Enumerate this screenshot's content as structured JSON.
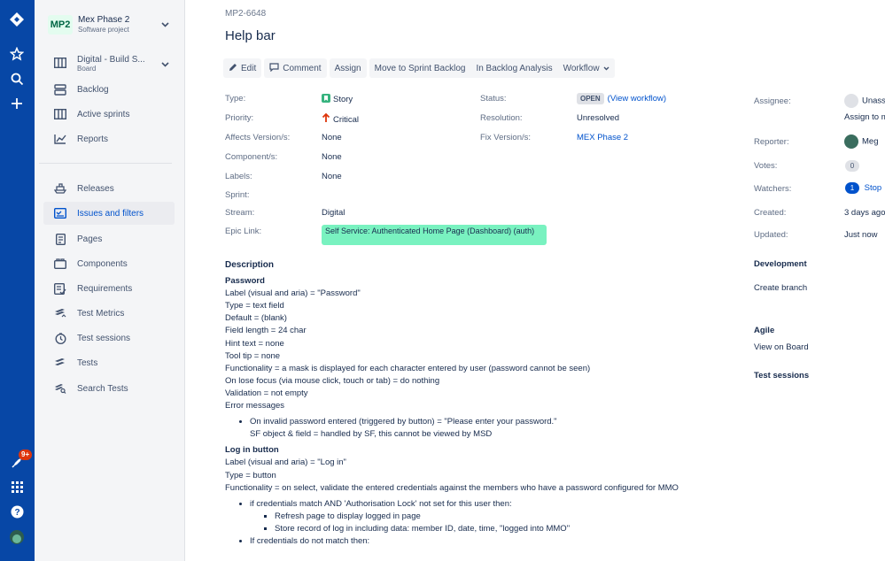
{
  "sidebar": {
    "project_logo": "MP2",
    "project_name": "Mex Phase 2",
    "project_type": "Software project",
    "board_name": "Digital - Build S...",
    "board_type": "Board",
    "items": [
      {
        "label": "Backlog",
        "icon": "backlog-icon"
      },
      {
        "label": "Active sprints",
        "icon": "board-icon"
      },
      {
        "label": "Reports",
        "icon": "chart-icon"
      },
      {
        "label": "Releases",
        "icon": "ship-icon"
      },
      {
        "label": "Issues and filters",
        "icon": "issues-icon"
      },
      {
        "label": "Pages",
        "icon": "page-icon"
      },
      {
        "label": "Components",
        "icon": "component-icon"
      },
      {
        "label": "Requirements",
        "icon": "requirements-icon"
      },
      {
        "label": "Test Metrics",
        "icon": "test-metrics-icon"
      },
      {
        "label": "Test sessions",
        "icon": "test-sessions-icon"
      },
      {
        "label": "Tests",
        "icon": "tests-icon"
      },
      {
        "label": "Search Tests",
        "icon": "search-tests-icon"
      }
    ],
    "notification_badge": "9+"
  },
  "issue": {
    "key": "MP2-6648",
    "title": "Help bar",
    "toolbar": {
      "edit": "Edit",
      "comment": "Comment",
      "assign": "Assign",
      "move_sprint": "Move to Sprint Backlog",
      "backlog_analysis": "In Backlog Analysis",
      "workflow": "Workflow"
    },
    "fields": {
      "type_label": "Type:",
      "type_value": "Story",
      "priority_label": "Priority:",
      "priority_value": "Critical",
      "affects_label": "Affects Version/s:",
      "affects_value": "None",
      "component_label": "Component/s:",
      "component_value": "None",
      "labels_label": "Labels:",
      "labels_value": "None",
      "sprint_label": "Sprint:",
      "stream_label": "Stream:",
      "stream_value": "Digital",
      "epic_label": "Epic Link:",
      "epic_value": "Self Service: Authenticated Home Page (Dashboard) (auth)",
      "status_label": "Status:",
      "status_value": "OPEN",
      "view_workflow": "(View workflow)",
      "resolution_label": "Resolution:",
      "resolution_value": "Unresolved",
      "fix_label": "Fix Version/s:",
      "fix_value": "MEX Phase 2"
    },
    "description": {
      "heading": "Description",
      "password_heading": "Password",
      "password_lines": [
        "Label (visual and aria) = \"Password\"",
        "Type = text field",
        "Default = (blank)",
        "Field length = 24 char",
        "Hint text = none",
        "Tool tip = none",
        "Functionality = a mask is displayed for each character entered by user (password cannot be seen)",
        "On lose focus (via mouse click, touch or tab) = do nothing",
        "Validation = not empty",
        "Error messages"
      ],
      "error_bullet_1": "On invalid password entered (triggered by button) = \"Please enter your password.\"",
      "error_bullet_2": "SF object & field = handled by SF, this cannot be viewed by MSD",
      "login_heading": "Log in button",
      "login_lines": [
        "Label (visual and aria) = \"Log in\"",
        "Type = button",
        "Functionality = on select, validate the entered credentials against the members who have a password configured for MMO"
      ],
      "cred_match": "if credentials match AND 'Authorisation Lock' not set for this user then:",
      "refresh": "Refresh page to display logged in page",
      "store": "Store record of log in including data: member ID, date, time, \"logged into MMO\"",
      "cred_nomatch": "If credentials do not match then:"
    }
  },
  "people": {
    "assignee_label": "Assignee:",
    "assignee_value": "Unass",
    "assign_me": "Assign to m",
    "reporter_label": "Reporter:",
    "reporter_value": "Meg",
    "votes_label": "Votes:",
    "votes_value": "0",
    "watchers_label": "Watchers:",
    "watchers_count": "1",
    "watchers_action": "Stop",
    "created_label": "Created:",
    "created_value": "3 days ago",
    "updated_label": "Updated:",
    "updated_value": "Just now"
  },
  "development": {
    "heading": "Development",
    "create_branch": "Create branch"
  },
  "agile": {
    "heading": "Agile",
    "view_board": "View on Board"
  },
  "test_sessions": {
    "heading": "Test sessions"
  }
}
